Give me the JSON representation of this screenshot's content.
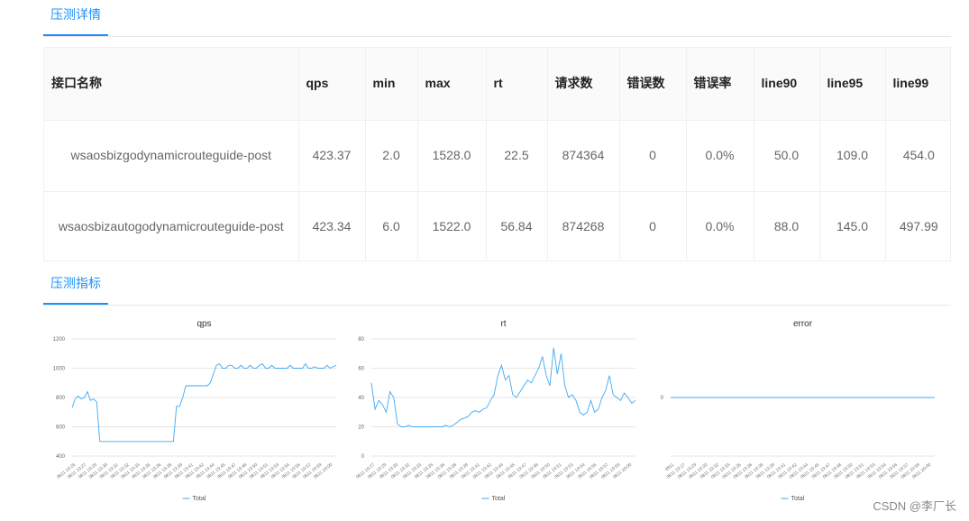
{
  "sections": {
    "detail_title": "压测详情",
    "metrics_title": "压测指标"
  },
  "table": {
    "headers": [
      "接口名称",
      "qps",
      "min",
      "max",
      "rt",
      "请求数",
      "错误数",
      "错误率",
      "line90",
      "line95",
      "line99"
    ],
    "rows": [
      [
        "wsaosbizgodynamicrouteguide-post",
        "423.37",
        "2.0",
        "1528.0",
        "22.5",
        "874364",
        "0",
        "0.0%",
        "50.0",
        "109.0",
        "454.0"
      ],
      [
        "wsaosbizautogodynamicrouteguide-post",
        "423.34",
        "6.0",
        "1522.0",
        "56.84",
        "874268",
        "0",
        "0.0%",
        "88.0",
        "145.0",
        "497.99"
      ]
    ]
  },
  "chart_data": [
    {
      "type": "line",
      "title": "qps",
      "legend": "bottom",
      "series": [
        {
          "name": "Total",
          "color": "#3fa9f5",
          "values": [
            730,
            790,
            810,
            790,
            800,
            840,
            780,
            790,
            770,
            500,
            500,
            500,
            500,
            500,
            500,
            500,
            500,
            500,
            500,
            500,
            500,
            500,
            500,
            500,
            500,
            500,
            500,
            500,
            500,
            500,
            500,
            500,
            500,
            500,
            740,
            740,
            800,
            880,
            880,
            880,
            880,
            880,
            880,
            880,
            880,
            900,
            960,
            1020,
            1030,
            1000,
            1000,
            1020,
            1020,
            1000,
            1000,
            1020,
            1000,
            1000,
            1020,
            1000,
            1000,
            1020,
            1030,
            1000,
            1000,
            1020,
            1000,
            1000,
            1000,
            1000,
            1000,
            1020,
            1000,
            1000,
            1000,
            1000,
            1030,
            1000,
            1000,
            1010,
            1000,
            1000,
            1000,
            1020,
            1000,
            1010,
            1020
          ]
        }
      ],
      "ylim": [
        400,
        1200
      ],
      "yticks": [
        400,
        600,
        800,
        1000,
        1200
      ],
      "xticks": [
        "0811 19:26",
        "0811 19:27",
        "0811 19:29",
        "0811 19:30",
        "0811 19:31",
        "0811 19:32",
        "0811 19:33",
        "0811 19:35",
        "0811 19:36",
        "0811 19:38",
        "0811 19:39",
        "0811 19:41",
        "0811 19:42",
        "0811 19:44",
        "0811 19:45",
        "0811 19:47",
        "0811 19:48",
        "0811 19:50",
        "0811 19:51",
        "0811 19:53",
        "0811 19:54",
        "0811 19:56",
        "0811 19:57",
        "0811 19:59",
        "0811 20:00"
      ],
      "grid": true
    },
    {
      "type": "line",
      "title": "rt",
      "legend": "bottom",
      "series": [
        {
          "name": "Total",
          "color": "#3fa9f5",
          "values": [
            50,
            32,
            38,
            35,
            30,
            44,
            40,
            22,
            20,
            20,
            21,
            20,
            20,
            20,
            20,
            20,
            20,
            20,
            20,
            20,
            21,
            20,
            21,
            23,
            25,
            26,
            27,
            30,
            31,
            30,
            32,
            33,
            38,
            42,
            55,
            62,
            52,
            55,
            42,
            40,
            44,
            48,
            52,
            50,
            55,
            60,
            68,
            55,
            48,
            74,
            56,
            70,
            48,
            40,
            42,
            38,
            30,
            28,
            30,
            38,
            30,
            32,
            40,
            45,
            55,
            42,
            40,
            38,
            43,
            40,
            36,
            38
          ]
        }
      ],
      "ylim": [
        0,
        80
      ],
      "yticks": [
        0,
        20,
        40,
        60,
        80
      ],
      "xticks": [
        "0811 19:27",
        "0811 19:29",
        "0811 19:30",
        "0811 19:32",
        "0811 19:33",
        "0811 19:35",
        "0811 19:36",
        "0811 19:38",
        "0811 19:39",
        "0811 19:41",
        "0811 19:42",
        "0811 19:44",
        "0811 19:45",
        "0811 19:47",
        "0811 19:48",
        "0811 19:50",
        "0811 19:51",
        "0811 19:53",
        "0811 19:54",
        "0811 19:56",
        "0811 19:57",
        "0811 19:59",
        "0811 20:00"
      ],
      "grid": true
    },
    {
      "type": "line",
      "title": "error",
      "legend": "bottom",
      "series": [
        {
          "name": "Total",
          "color": "#3fa9f5",
          "values": [
            0,
            0,
            0,
            0,
            0,
            0,
            0,
            0,
            0,
            0,
            0,
            0,
            0,
            0,
            0,
            0,
            0,
            0,
            0,
            0,
            0,
            0,
            0,
            0,
            0,
            0
          ]
        }
      ],
      "ylim": [
        -1,
        1
      ],
      "yticks": [
        0
      ],
      "xticks": [
        "0811",
        "0811 19:27",
        "0811 19:29",
        "0811 19:30",
        "0811 19:32",
        "0811 19:33",
        "0811 19:35",
        "0811 19:36",
        "0811 19:38",
        "0811 19:39",
        "0811 19:41",
        "0811 19:42",
        "0811 19:44",
        "0811 19:45",
        "0811 19:47",
        "0811 19:48",
        "0811 19:50",
        "0811 19:51",
        "0811 19:53",
        "0811 19:54",
        "0811 19:56",
        "0811 19:57",
        "0811 19:59",
        "0811 20:00"
      ],
      "grid": false
    }
  ],
  "watermark": "CSDN @李厂长"
}
